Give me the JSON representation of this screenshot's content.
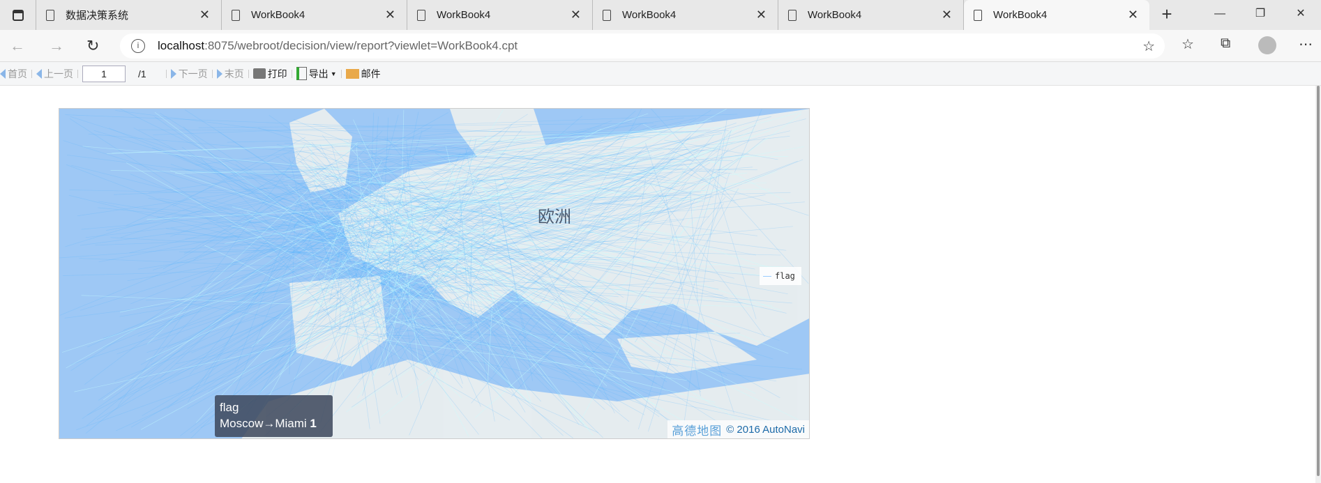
{
  "browser": {
    "tabs": [
      {
        "label": "数据决策系统"
      },
      {
        "label": "WorkBook4"
      },
      {
        "label": "WorkBook4"
      },
      {
        "label": "WorkBook4"
      },
      {
        "label": "WorkBook4"
      },
      {
        "label": "WorkBook4",
        "active": true
      }
    ],
    "url_host": "localhost",
    "url_rest": ":8075/webroot/decision/view/report?viewlet=WorkBook4.cpt"
  },
  "toolbar": {
    "first": "首页",
    "prev": "上一页",
    "page_value": "1",
    "page_total": "/1",
    "next": "下一页",
    "last": "末页",
    "print": "打印",
    "export": "导出",
    "mail": "邮件"
  },
  "map": {
    "region_label": "欧洲",
    "legend": "flag",
    "tooltip": {
      "series": "flag",
      "route": "Moscow→Miami",
      "value": "1"
    },
    "attribution_logo": "高德地图",
    "attribution": "© 2016 AutoNavi",
    "colors": {
      "sea": "#9ec8f5",
      "land": "#eef2f0",
      "line": "#4fb3ff",
      "hot": "#c8ffff"
    }
  }
}
